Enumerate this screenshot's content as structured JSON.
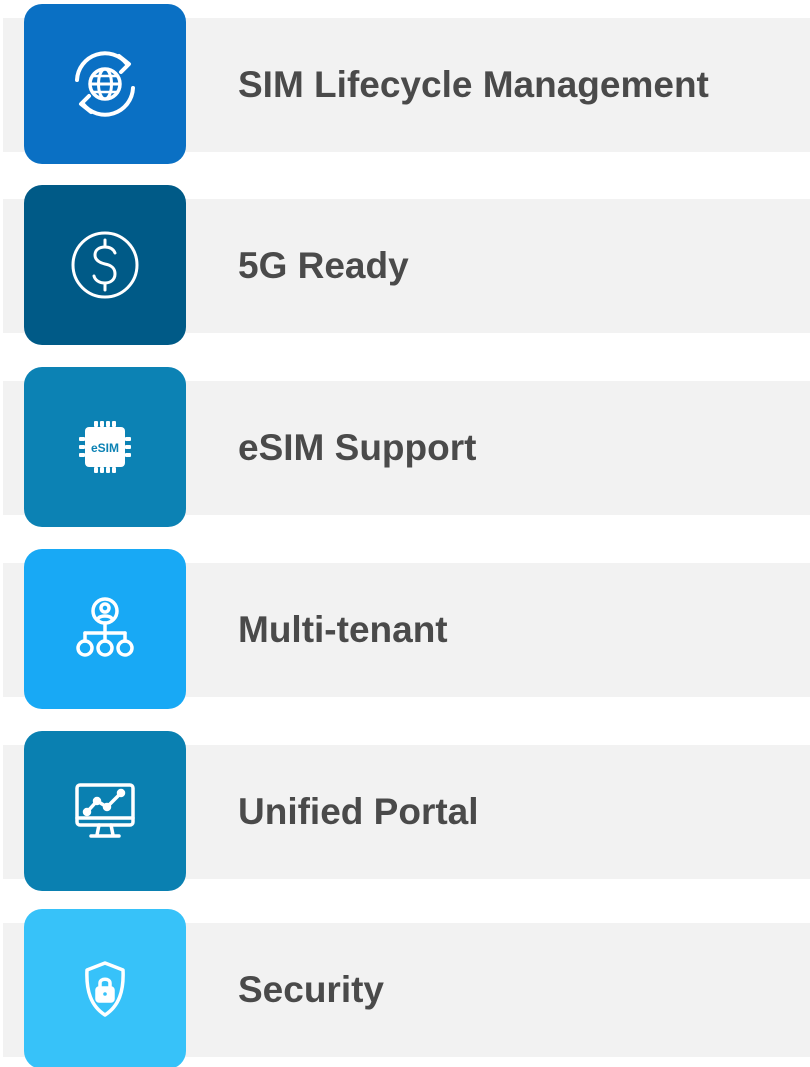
{
  "features": [
    {
      "label": "SIM Lifecycle Management",
      "icon": "globe-refresh-icon",
      "color": "#0a70c4"
    },
    {
      "label": "5G Ready",
      "icon": "dollar-circle-icon",
      "color": "#005a87"
    },
    {
      "label": "eSIM Support",
      "icon": "esim-chip-icon",
      "chip_text": "eSIM",
      "color": "#0c82b4"
    },
    {
      "label": "Multi-tenant",
      "icon": "user-hierarchy-icon",
      "color": "#18a9f5"
    },
    {
      "label": "Unified Portal",
      "icon": "monitor-chart-icon",
      "color": "#0a80b1"
    },
    {
      "label": "Security",
      "icon": "shield-lock-icon",
      "color": "#37c2f9"
    }
  ]
}
